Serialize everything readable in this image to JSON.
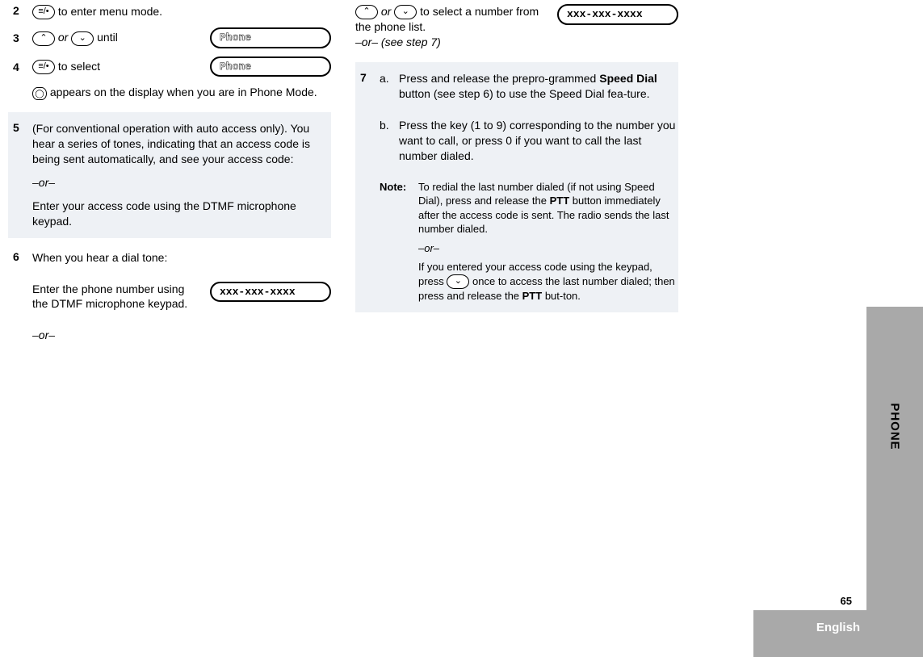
{
  "left": {
    "step2": {
      "num": "2",
      "icon": "≡/•",
      "text": " to enter menu mode."
    },
    "step3": {
      "num": "3",
      "up": "⌃",
      "down": "⌄",
      "or": " or ",
      "until": " until",
      "display": "Phone"
    },
    "step4": {
      "num": "4",
      "icon": "≡/•",
      "text": " to select",
      "display": "Phone",
      "note_icon": "◯",
      "note_text": " appears on the display when you are in Phone Mode."
    },
    "step5": {
      "num": "5",
      "line1": "(For conventional operation with auto access only). You hear a series of tones, indicating that an access code is being sent automatically, and see your access code:",
      "or": " –or–",
      "line2": "Enter your access code using the DTMF microphone keypad."
    },
    "step6": {
      "num": "6",
      "intro": "When you hear a dial tone:",
      "enter_text": "Enter the phone number using the DTMF microphone keypad.",
      "display": "xxx-xxx-xxxx",
      "or": "–or–"
    }
  },
  "right": {
    "top": {
      "up": "⌃",
      "down": "⌄",
      "or": " or ",
      "text": "   to select a number from the phone list.",
      "or2": " –or– (see step 7)",
      "display": "xxx-xxx-xxxx"
    },
    "step7": {
      "num": "7",
      "a_letter": "a.",
      "a_text1": "Press and release the prepro-grammed ",
      "a_bold": "Speed Dial",
      "a_text2": " button (see step  6) to use the Speed Dial fea-ture.",
      "b_letter": "b.",
      "b_text": "Press the key (1 to 9) corresponding to the number you want to call, or press 0 if you want to call the last number dialed.",
      "note_label": "Note:",
      "note_text1": "To redial the last number dialed (if not using Speed Dial), press and release the ",
      "note_bold1": "PTT",
      "note_text2": " button immediately after the access code is sent. The radio sends the last number dialed.",
      "or": "–or–",
      "note_text3a": "If you entered your access code using the keypad, press ",
      "down": "⌄",
      "note_text3b": "    once to access the last number dialed; then press and release the ",
      "note_bold2": "PTT",
      "note_text3c": " but-ton."
    }
  },
  "sidebar": "PHONE",
  "pagenum": "65",
  "footer": "English"
}
